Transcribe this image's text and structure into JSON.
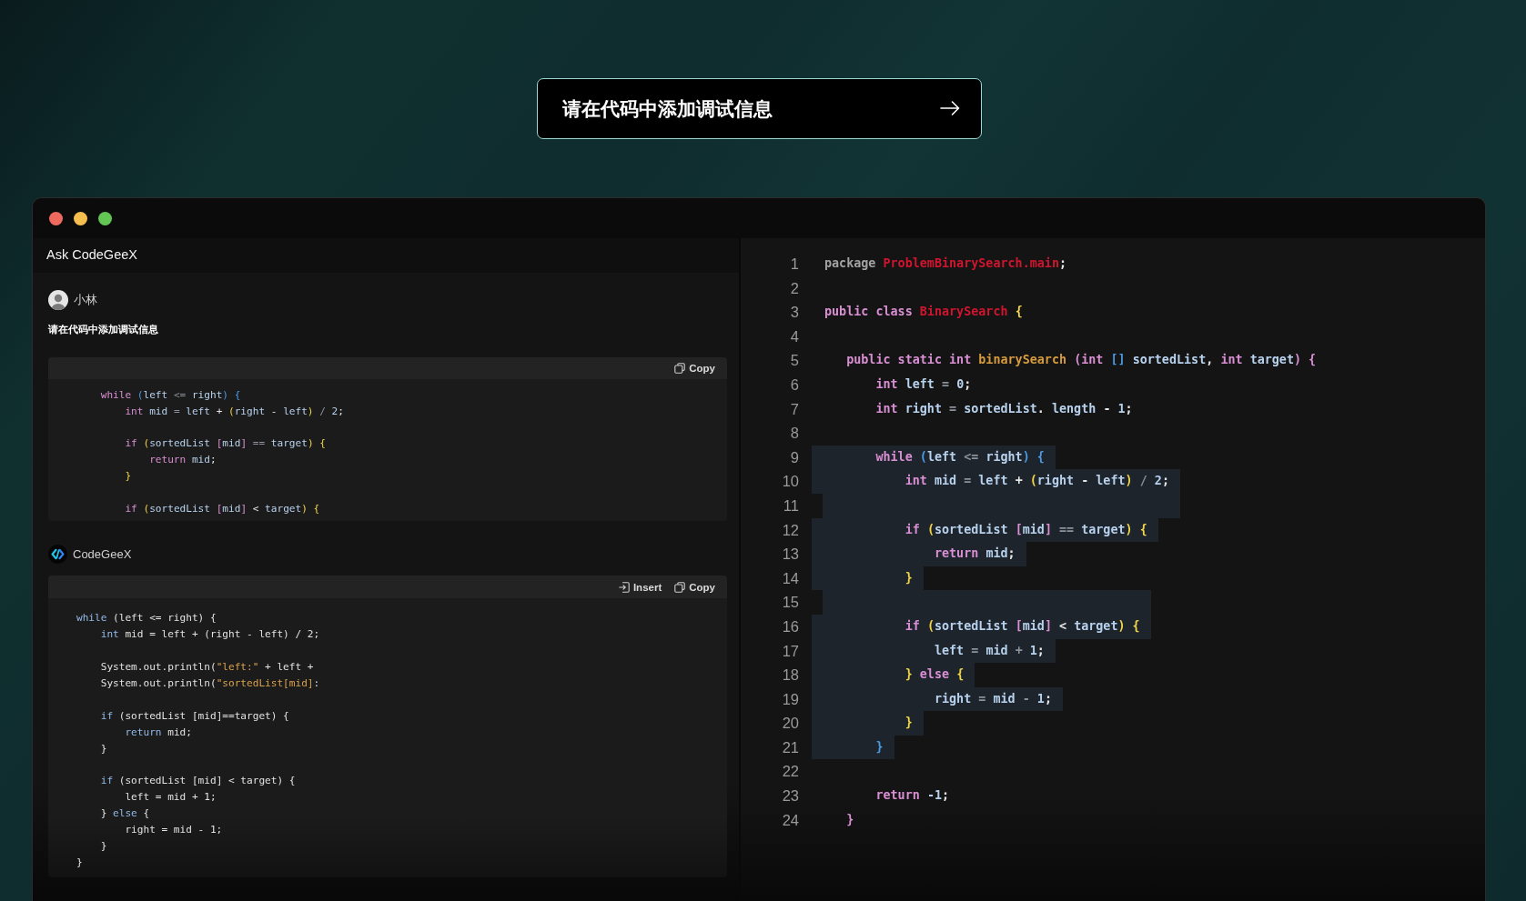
{
  "prompt": {
    "value": "请在代码中添加调试信息"
  },
  "chat": {
    "panel_title": "Ask CodeGeeX",
    "messages": [
      {
        "kind": "user",
        "author": "小林",
        "text": "请在代码中添加调试信息",
        "code": {
          "actions": [
            {
              "kind": "copy",
              "label": "Copy"
            }
          ],
          "lines": [
            {
              "kind": "code",
              "tokens": [
                {
                  "kind": "kw",
                  "text": "    while "
                },
                {
                  "kind": "br3",
                  "text": "("
                },
                {
                  "kind": "id",
                  "text": "left "
                },
                {
                  "kind": "op",
                  "text": "<= "
                },
                {
                  "kind": "id",
                  "text": "right"
                },
                {
                  "kind": "br3",
                  "text": ") {"
                }
              ]
            },
            {
              "kind": "code",
              "tokens": [
                {
                  "kind": "kw",
                  "text": "        int "
                },
                {
                  "kind": "id",
                  "text": "mid "
                },
                {
                  "kind": "op",
                  "text": "= "
                },
                {
                  "kind": "id",
                  "text": "left "
                },
                {
                  "kind": "pun",
                  "text": "+ "
                },
                {
                  "kind": "br1",
                  "text": "("
                },
                {
                  "kind": "id",
                  "text": "right "
                },
                {
                  "kind": "pun",
                  "text": "- "
                },
                {
                  "kind": "id",
                  "text": "left"
                },
                {
                  "kind": "br1",
                  "text": ") "
                },
                {
                  "kind": "op",
                  "text": "/ "
                },
                {
                  "kind": "num",
                  "text": "2"
                },
                {
                  "kind": "pun",
                  "text": ";"
                }
              ]
            },
            {
              "kind": "blank"
            },
            {
              "kind": "code",
              "tokens": [
                {
                  "kind": "kw",
                  "text": "        if "
                },
                {
                  "kind": "br1",
                  "text": "("
                },
                {
                  "kind": "id",
                  "text": "sortedList "
                },
                {
                  "kind": "br2",
                  "text": "["
                },
                {
                  "kind": "id",
                  "text": "mid"
                },
                {
                  "kind": "br2",
                  "text": "] "
                },
                {
                  "kind": "op",
                  "text": "== "
                },
                {
                  "kind": "id",
                  "text": "target"
                },
                {
                  "kind": "br1",
                  "text": ") {"
                }
              ]
            },
            {
              "kind": "code",
              "tokens": [
                {
                  "kind": "kw",
                  "text": "            return "
                },
                {
                  "kind": "id",
                  "text": "mid"
                },
                {
                  "kind": "pun",
                  "text": ";"
                }
              ]
            },
            {
              "kind": "code",
              "tokens": [
                {
                  "kind": "br1",
                  "text": "        }"
                }
              ]
            },
            {
              "kind": "blank"
            },
            {
              "kind": "code",
              "tokens": [
                {
                  "kind": "kw",
                  "text": "        if "
                },
                {
                  "kind": "br1",
                  "text": "("
                },
                {
                  "kind": "id",
                  "text": "sortedList "
                },
                {
                  "kind": "br2",
                  "text": "["
                },
                {
                  "kind": "id",
                  "text": "mid"
                },
                {
                  "kind": "br2",
                  "text": "] "
                },
                {
                  "kind": "pun",
                  "text": "< "
                },
                {
                  "kind": "id",
                  "text": "target"
                },
                {
                  "kind": "br1",
                  "text": ") {"
                }
              ]
            }
          ]
        }
      },
      {
        "kind": "assistant",
        "author": "CodeGeeX",
        "code": {
          "actions": [
            {
              "kind": "insert",
              "label": "Insert"
            },
            {
              "kind": "copy",
              "label": "Copy"
            }
          ],
          "lines": [
            {
              "kind": "code",
              "tokens": [
                {
                  "kind": "kwb",
                  "text": "while "
                },
                {
                  "kind": "txt",
                  "text": "(left <= right) {"
                }
              ]
            },
            {
              "kind": "code",
              "tokens": [
                {
                  "kind": "kwb",
                  "text": "    int "
                },
                {
                  "kind": "txt",
                  "text": "mid = left + (right - left) / 2;"
                }
              ]
            },
            {
              "kind": "blank"
            },
            {
              "kind": "code",
              "tokens": [
                {
                  "kind": "txt",
                  "text": "    System.out.println("
                },
                {
                  "kind": "str",
                  "text": "\"left:\""
                },
                {
                  "kind": "txt",
                  "text": " + left +"
                }
              ]
            },
            {
              "kind": "code",
              "tokens": [
                {
                  "kind": "txt",
                  "text": "    System.out.println("
                },
                {
                  "kind": "str",
                  "text": "\"sortedList[mid]"
                },
                {
                  "kind": "txt",
                  "text": ":"
                }
              ]
            },
            {
              "kind": "blank"
            },
            {
              "kind": "code",
              "tokens": [
                {
                  "kind": "kwb",
                  "text": "    if "
                },
                {
                  "kind": "txt",
                  "text": "(sortedList [mid]==target) {"
                }
              ]
            },
            {
              "kind": "code",
              "tokens": [
                {
                  "kind": "kwb",
                  "text": "        return "
                },
                {
                  "kind": "txt",
                  "text": "mid;"
                }
              ]
            },
            {
              "kind": "code",
              "tokens": [
                {
                  "kind": "txt",
                  "text": "    }"
                }
              ]
            },
            {
              "kind": "blank"
            },
            {
              "kind": "code",
              "tokens": [
                {
                  "kind": "kwb",
                  "text": "    if "
                },
                {
                  "kind": "txt",
                  "text": "(sortedList [mid] < target) {"
                }
              ]
            },
            {
              "kind": "code",
              "tokens": [
                {
                  "kind": "txt",
                  "text": "        left = mid + 1;"
                }
              ]
            },
            {
              "kind": "code",
              "tokens": [
                {
                  "kind": "txt",
                  "text": "    } "
                },
                {
                  "kind": "kwb",
                  "text": "else "
                },
                {
                  "kind": "txt",
                  "text": "{"
                }
              ]
            },
            {
              "kind": "code",
              "tokens": [
                {
                  "kind": "txt",
                  "text": "        right = mid - 1;"
                }
              ]
            },
            {
              "kind": "code",
              "tokens": [
                {
                  "kind": "txt",
                  "text": "    }"
                }
              ]
            },
            {
              "kind": "code",
              "tokens": [
                {
                  "kind": "txt",
                  "text": "}"
                }
              ]
            }
          ]
        }
      }
    ]
  },
  "editor": {
    "lines": [
      {
        "number": "1",
        "highlighted": false,
        "tokens": [
          {
            "kind": "pkg",
            "text": "package "
          },
          {
            "kind": "cls",
            "text": "ProblemBinarySearch.main"
          },
          {
            "kind": "pun",
            "text": ";"
          }
        ]
      },
      {
        "number": "2",
        "highlighted": false
      },
      {
        "number": "3",
        "highlighted": false,
        "tokens": [
          {
            "kind": "kw",
            "text": "public class "
          },
          {
            "kind": "cls",
            "text": "BinarySearch "
          },
          {
            "kind": "br1",
            "text": "{"
          }
        ]
      },
      {
        "number": "4",
        "highlighted": false
      },
      {
        "number": "5",
        "highlighted": false,
        "tokens": [
          {
            "kind": "kw",
            "text": "   public static int "
          },
          {
            "kind": "fn",
            "text": "binarySearch "
          },
          {
            "kind": "br2",
            "text": "("
          },
          {
            "kind": "kw",
            "text": "int "
          },
          {
            "kind": "br3",
            "text": "[] "
          },
          {
            "kind": "id",
            "text": "sortedList"
          },
          {
            "kind": "pun",
            "text": ", "
          },
          {
            "kind": "kw",
            "text": "int "
          },
          {
            "kind": "id",
            "text": "target"
          },
          {
            "kind": "br2",
            "text": ") {"
          }
        ]
      },
      {
        "number": "6",
        "highlighted": false,
        "tokens": [
          {
            "kind": "kw",
            "text": "       int "
          },
          {
            "kind": "id",
            "text": "left "
          },
          {
            "kind": "op",
            "text": "= "
          },
          {
            "kind": "num",
            "text": "0"
          },
          {
            "kind": "pun",
            "text": ";"
          }
        ]
      },
      {
        "number": "7",
        "highlighted": false,
        "tokens": [
          {
            "kind": "kw",
            "text": "       int "
          },
          {
            "kind": "id",
            "text": "right "
          },
          {
            "kind": "op",
            "text": "= "
          },
          {
            "kind": "id",
            "text": "sortedList"
          },
          {
            "kind": "pun",
            "text": ". "
          },
          {
            "kind": "id",
            "text": "length "
          },
          {
            "kind": "pun",
            "text": "- "
          },
          {
            "kind": "num",
            "text": "1"
          },
          {
            "kind": "pun",
            "text": ";"
          }
        ]
      },
      {
        "number": "8",
        "highlighted": false
      },
      {
        "number": "9",
        "highlighted": true,
        "tokens": [
          {
            "kind": "kw",
            "text": "       while "
          },
          {
            "kind": "br3",
            "text": "("
          },
          {
            "kind": "id",
            "text": "left "
          },
          {
            "kind": "op",
            "text": "<= "
          },
          {
            "kind": "id",
            "text": "right"
          },
          {
            "kind": "br3",
            "text": ") {"
          }
        ]
      },
      {
        "number": "10",
        "highlighted": true,
        "tokens": [
          {
            "kind": "kw",
            "text": "           int "
          },
          {
            "kind": "id",
            "text": "mid "
          },
          {
            "kind": "op",
            "text": "= "
          },
          {
            "kind": "id",
            "text": "left "
          },
          {
            "kind": "pun",
            "text": "+ "
          },
          {
            "kind": "br1",
            "text": "("
          },
          {
            "kind": "id",
            "text": "right "
          },
          {
            "kind": "pun",
            "text": "- "
          },
          {
            "kind": "id",
            "text": "left"
          },
          {
            "kind": "br1",
            "text": ") "
          },
          {
            "kind": "op",
            "text": "/ "
          },
          {
            "kind": "num",
            "text": "2"
          },
          {
            "kind": "pun",
            "text": ";"
          }
        ]
      },
      {
        "number": "11",
        "highlighted": true
      },
      {
        "number": "12",
        "highlighted": true,
        "tokens": [
          {
            "kind": "kw",
            "text": "           if "
          },
          {
            "kind": "br1",
            "text": "("
          },
          {
            "kind": "id",
            "text": "sortedList "
          },
          {
            "kind": "br2",
            "text": "["
          },
          {
            "kind": "id",
            "text": "mid"
          },
          {
            "kind": "br2",
            "text": "] "
          },
          {
            "kind": "op",
            "text": "== "
          },
          {
            "kind": "id",
            "text": "target"
          },
          {
            "kind": "br1",
            "text": ") {"
          }
        ]
      },
      {
        "number": "13",
        "highlighted": true,
        "tokens": [
          {
            "kind": "kw",
            "text": "               return "
          },
          {
            "kind": "id",
            "text": "mid"
          },
          {
            "kind": "pun",
            "text": ";"
          }
        ]
      },
      {
        "number": "14",
        "highlighted": true,
        "tokens": [
          {
            "kind": "br1",
            "text": "           }"
          }
        ]
      },
      {
        "number": "15",
        "highlighted": true
      },
      {
        "number": "16",
        "highlighted": true,
        "tokens": [
          {
            "kind": "kw",
            "text": "           if "
          },
          {
            "kind": "br1",
            "text": "("
          },
          {
            "kind": "id",
            "text": "sortedList "
          },
          {
            "kind": "br2",
            "text": "["
          },
          {
            "kind": "id",
            "text": "mid"
          },
          {
            "kind": "br2",
            "text": "] "
          },
          {
            "kind": "pun",
            "text": "< "
          },
          {
            "kind": "id",
            "text": "target"
          },
          {
            "kind": "br1",
            "text": ") {"
          }
        ]
      },
      {
        "number": "17",
        "highlighted": true,
        "tokens": [
          {
            "kind": "id",
            "text": "               left "
          },
          {
            "kind": "op",
            "text": "= "
          },
          {
            "kind": "id",
            "text": "mid "
          },
          {
            "kind": "op",
            "text": "+ "
          },
          {
            "kind": "num",
            "text": "1"
          },
          {
            "kind": "pun",
            "text": ";"
          }
        ]
      },
      {
        "number": "18",
        "highlighted": true,
        "tokens": [
          {
            "kind": "br1",
            "text": "           } "
          },
          {
            "kind": "kw",
            "text": "else "
          },
          {
            "kind": "br1",
            "text": "{"
          }
        ]
      },
      {
        "number": "19",
        "highlighted": true,
        "tokens": [
          {
            "kind": "id",
            "text": "               right "
          },
          {
            "kind": "op",
            "text": "= "
          },
          {
            "kind": "id",
            "text": "mid "
          },
          {
            "kind": "op",
            "text": "- "
          },
          {
            "kind": "num",
            "text": "1"
          },
          {
            "kind": "pun",
            "text": ";"
          }
        ]
      },
      {
        "number": "20",
        "highlighted": true,
        "tokens": [
          {
            "kind": "br1",
            "text": "           }"
          }
        ]
      },
      {
        "number": "21",
        "highlighted": true,
        "tokens": [
          {
            "kind": "br3",
            "text": "       }"
          }
        ]
      },
      {
        "number": "22",
        "highlighted": false
      },
      {
        "number": "23",
        "highlighted": false,
        "tokens": [
          {
            "kind": "kw",
            "text": "       return "
          },
          {
            "kind": "num",
            "text": "-1"
          },
          {
            "kind": "pun",
            "text": ";"
          }
        ]
      },
      {
        "number": "24",
        "highlighted": false,
        "tokens": [
          {
            "kind": "br2",
            "text": "   }"
          }
        ]
      }
    ]
  }
}
